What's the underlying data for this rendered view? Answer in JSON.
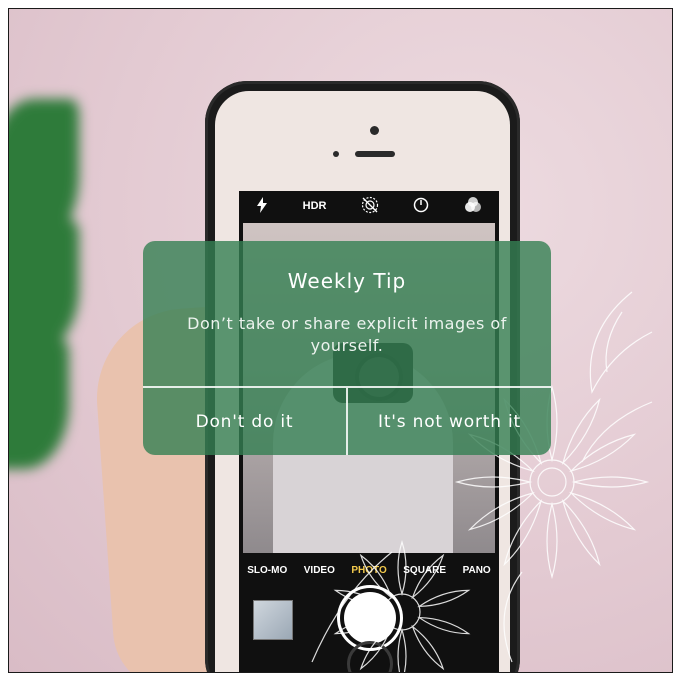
{
  "dialog": {
    "title": "Weekly Tip",
    "message": "Don’t take or share explicit images of yourself.",
    "button_left": "Don't do it",
    "button_right": "It's not worth it",
    "background_color": "#348052"
  },
  "camera_app": {
    "toolbar": {
      "flash_icon": "flash-icon",
      "hdr_label": "HDR",
      "live_icon": "live-photo-icon",
      "timer_icon": "timer-icon",
      "filters_icon": "filters-icon"
    },
    "modes": [
      "SLO-MO",
      "VIDEO",
      "PHOTO",
      "SQUARE",
      "PANO"
    ],
    "active_mode": "PHOTO",
    "active_mode_color": "#f2c94c"
  }
}
